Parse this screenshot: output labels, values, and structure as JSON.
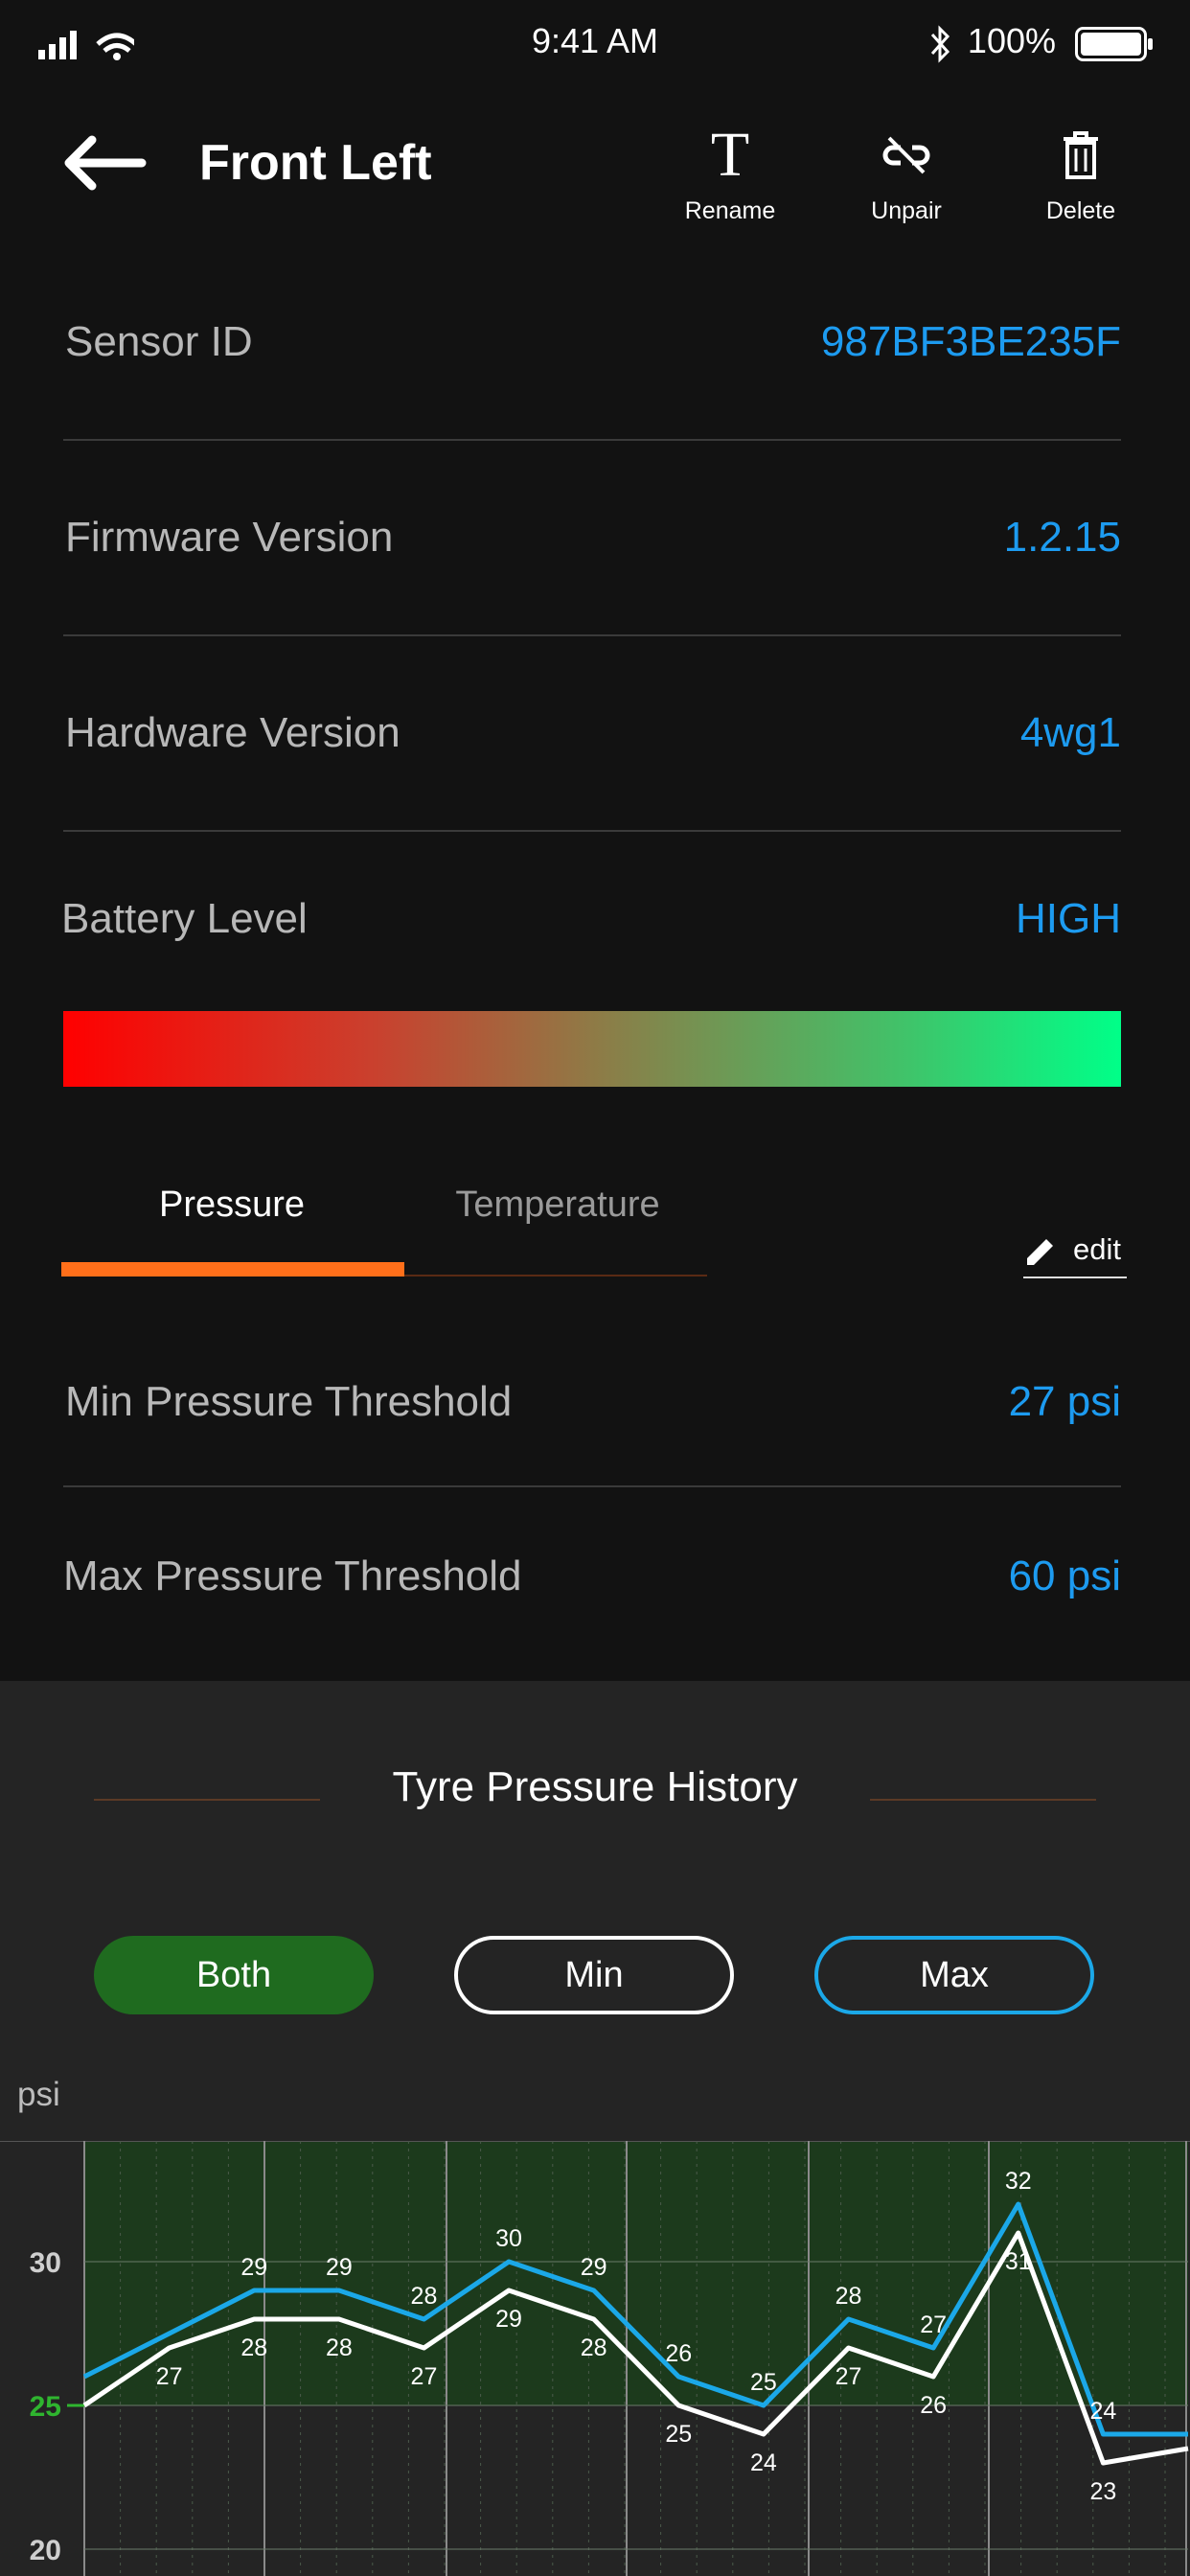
{
  "status_bar": {
    "time": "9:41 AM",
    "battery": "100%"
  },
  "header": {
    "title": "Front Left",
    "actions": [
      {
        "label": "Rename",
        "icon": "rename-icon"
      },
      {
        "label": "Unpair",
        "icon": "unlink-icon"
      },
      {
        "label": "Delete",
        "icon": "trash-icon"
      }
    ]
  },
  "info": [
    {
      "label": "Sensor ID",
      "value": "987BF3BE235F"
    },
    {
      "label": "Firmware Version",
      "value": "1.2.15"
    },
    {
      "label": "Hardware Version",
      "value": "4wg1"
    }
  ],
  "battery": {
    "label": "Battery Level",
    "value": "HIGH"
  },
  "tabs": {
    "items": [
      "Pressure",
      "Temperature"
    ],
    "active": "Pressure",
    "edit_label": "edit"
  },
  "thresholds": [
    {
      "label": "Min Pressure Threshold",
      "value": "27 psi"
    },
    {
      "label": "Max Pressure Threshold",
      "value": "60 psi"
    }
  ],
  "history": {
    "title": "Tyre Pressure History",
    "filters": [
      "Both",
      "Min",
      "Max"
    ],
    "active_filter": "Both"
  },
  "colors": {
    "accent": "#1d9bf0",
    "tab_active": "#ff6f1a",
    "both_green": "#1f6b1f",
    "threshold_green": "#2fb52f"
  },
  "chart_data": {
    "type": "line",
    "ylabel": "psi",
    "y_ticks": [
      20,
      25,
      30
    ],
    "threshold": 25,
    "series": [
      {
        "name": "Max",
        "color": "#1ba8e8",
        "values": [
          26,
          27.5,
          29,
          29,
          28,
          30,
          29,
          26,
          25,
          28,
          27,
          32,
          24,
          24
        ],
        "labels": [
          null,
          null,
          "29",
          "29",
          "28",
          "30",
          "29",
          "26",
          "25",
          "28",
          "27",
          "32",
          "24",
          null
        ]
      },
      {
        "name": "Min",
        "color": "#ffffff",
        "values": [
          25,
          27,
          28,
          28,
          27,
          29,
          28,
          25,
          24,
          27,
          26,
          31,
          23,
          23.5
        ],
        "labels": [
          null,
          "27",
          "28",
          "28",
          "27",
          "29",
          "28",
          "25",
          "24",
          "27",
          "26",
          "31",
          "23",
          null
        ]
      }
    ]
  }
}
